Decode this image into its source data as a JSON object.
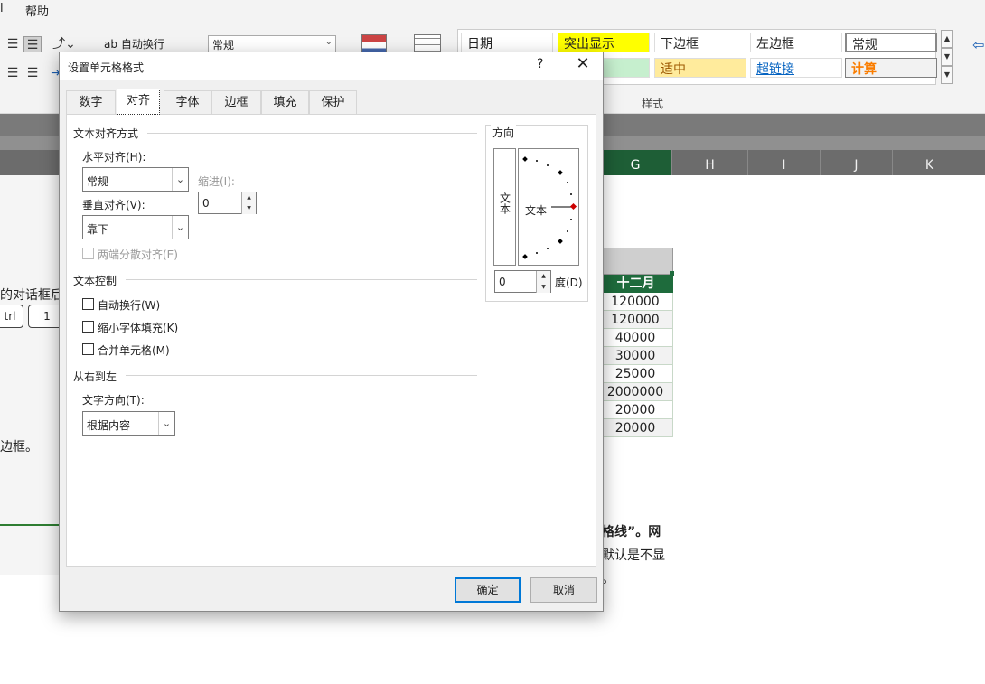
{
  "ribbon": {
    "menu_prev": "l",
    "menu_help": "帮助",
    "wrap_text": "自动换行",
    "number_format": "常规",
    "styles": [
      {
        "label": "日期",
        "bg": "#ffffff",
        "color": "#000000"
      },
      {
        "label": "突出显示",
        "bg": "#ffff00",
        "color": "#000000"
      },
      {
        "label": "下边框",
        "bg": "#ffffff",
        "color": "#000000"
      },
      {
        "label": "左边框",
        "bg": "#ffffff",
        "color": "#000000"
      },
      {
        "label": "常规",
        "bg": "#ffffff",
        "color": "#000000"
      },
      {
        "label": "",
        "bg": "#c6efce",
        "color": "#006100"
      },
      {
        "label": "适中",
        "bg": "#ffeb9c",
        "color": "#9c5700"
      },
      {
        "label": "超链接",
        "bg": "#ffffff",
        "color": "#0563c1"
      },
      {
        "label": "计算",
        "bg": "#f2f2f2",
        "color": "#fa7d00"
      }
    ],
    "styles_group": "样式"
  },
  "columns": [
    "G",
    "H",
    "I",
    "J",
    "K"
  ],
  "table": {
    "header": "十二月",
    "values": [
      "120000",
      "120000",
      "40000",
      "30000",
      "25000",
      "2000000",
      "20000",
      "20000"
    ]
  },
  "left_text": {
    "line1": "的对话框后",
    "key1": "trl",
    "key2": "1",
    "line2": "边框。"
  },
  "right_text": {
    "line1": "格线”。网",
    "line2": "默认是不显",
    "line3": "。"
  },
  "dialog": {
    "title": "设置单元格格式",
    "help": "?",
    "close": "✕",
    "tabs": [
      "数字",
      "对齐",
      "字体",
      "边框",
      "填充",
      "保护"
    ],
    "active_tab": "对齐",
    "text_alignment": {
      "group": "文本对齐方式",
      "horizontal_label": "水平对齐(H):",
      "horizontal_value": "常规",
      "indent_label": "缩进(I):",
      "indent_value": "0",
      "vertical_label": "垂直对齐(V):",
      "vertical_value": "靠下",
      "justify_distributed": "两端分散对齐(E)"
    },
    "text_control": {
      "group": "文本控制",
      "wrap": "自动换行(W)",
      "shrink": "缩小字体填充(K)",
      "merge": "合并单元格(M)"
    },
    "rtl": {
      "group": "从右到左",
      "direction_label": "文字方向(T):",
      "direction_value": "根据内容"
    },
    "orientation": {
      "group": "方向",
      "vertical_text": "文本",
      "dial_text": "文本",
      "degrees_value": "0",
      "degrees_label": "度(D)"
    },
    "ok": "确定",
    "cancel": "取消"
  }
}
